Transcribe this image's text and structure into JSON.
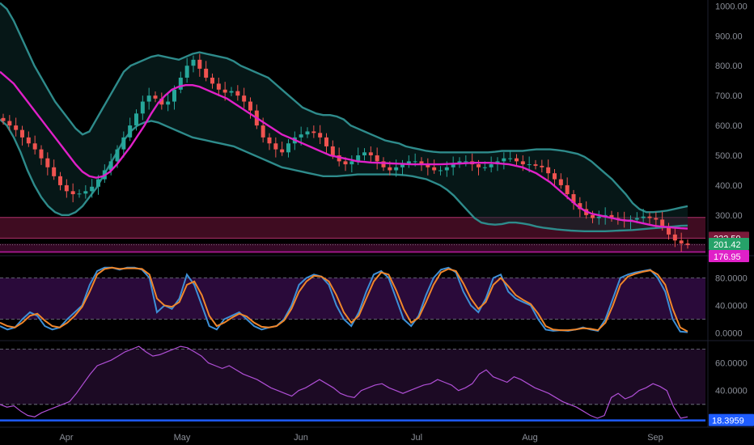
{
  "chart_data": [
    {
      "type": "candlestick",
      "panel": "price",
      "indicators": [
        "bollinger-bands",
        "moving-average"
      ],
      "y_ticks": [
        "1000.00",
        "900.00",
        "800.00",
        "700.00",
        "600.00",
        "500.00",
        "400.00",
        "300.00"
      ],
      "ylim": [
        175,
        1020
      ],
      "badges": [
        {
          "label": "222.59",
          "value": 222.59,
          "color": "#7a1a3a",
          "text_color": "#ffffff"
        },
        {
          "label": "201.42",
          "value": 201.42,
          "color": "#26a269",
          "text_color": "#ffffff"
        },
        {
          "label": "176.95",
          "value": 176.95,
          "color": "#e020c8",
          "text_color": "#ffffff"
        }
      ],
      "colors": {
        "up": "#26a69a",
        "down": "#ef5350",
        "bands": "#2e8b8b",
        "ma": "#e020c8",
        "zone": "#8b1a4a"
      },
      "closes": [
        615,
        600,
        585,
        560,
        540,
        520,
        490,
        460,
        430,
        400,
        380,
        370,
        372,
        380,
        395,
        420,
        450,
        480,
        520,
        560,
        600,
        640,
        680,
        700,
        690,
        670,
        680,
        720,
        760,
        800,
        820,
        790,
        760,
        740,
        720,
        710,
        715,
        700,
        680,
        650,
        600,
        560,
        540,
        520,
        510,
        540,
        560,
        570,
        580,
        575,
        560,
        530,
        500,
        480,
        470,
        480,
        500,
        510,
        500,
        480,
        460,
        450,
        460,
        470,
        480,
        480,
        470,
        460,
        450,
        450,
        460,
        470,
        480,
        480,
        470,
        460,
        460,
        470,
        480,
        490,
        490,
        480,
        470,
        470,
        465,
        460,
        440,
        420,
        400,
        370,
        340,
        320,
        300,
        290,
        295,
        300,
        290,
        285,
        280,
        285,
        290,
        295,
        290,
        285,
        260,
        235,
        215,
        205,
        200
      ],
      "series": [
        {
          "name": "BB upper",
          "values": [
            1010,
            990,
            950,
            900,
            850,
            800,
            760,
            720,
            680,
            650,
            620,
            590,
            570,
            580,
            620,
            660,
            700,
            740,
            780,
            800,
            810,
            820,
            830,
            835,
            830,
            825,
            820,
            830,
            840,
            845,
            840,
            835,
            830,
            825,
            815,
            800,
            790,
            780,
            770,
            760,
            740,
            720,
            700,
            680,
            660,
            650,
            640,
            635,
            635,
            630,
            620,
            600,
            590,
            580,
            570,
            560,
            550,
            545,
            540,
            530,
            525,
            520,
            515,
            512,
            510,
            510,
            510,
            510,
            510,
            510,
            510,
            510,
            512,
            515,
            515,
            515,
            515,
            518,
            520,
            520,
            520,
            518,
            515,
            510,
            505,
            495,
            480,
            460,
            440,
            420,
            395,
            370,
            340,
            320,
            310,
            310,
            312,
            315,
            320,
            325,
            330
          ]
        },
        {
          "name": "Moving average",
          "values": [
            780,
            760,
            740,
            710,
            680,
            650,
            620,
            590,
            560,
            530,
            500,
            470,
            445,
            430,
            425,
            430,
            445,
            470,
            500,
            530,
            565,
            600,
            640,
            675,
            700,
            720,
            730,
            735,
            735,
            730,
            720,
            710,
            700,
            690,
            675,
            660,
            645,
            630,
            615,
            600,
            585,
            570,
            560,
            550,
            540,
            530,
            520,
            510,
            500,
            495,
            490,
            485,
            480,
            478,
            476,
            475,
            474,
            473,
            472,
            471,
            470,
            470,
            470,
            470,
            470,
            471,
            472,
            473,
            474,
            475,
            475,
            475,
            474,
            472,
            470,
            465,
            460,
            450,
            440,
            425,
            410,
            390,
            370,
            350,
            330,
            315,
            305,
            300,
            295,
            290,
            285,
            282,
            280,
            275,
            270,
            265,
            262,
            260,
            258,
            256,
            255
          ]
        },
        {
          "name": "BB lower",
          "values": [
            620,
            600,
            560,
            510,
            450,
            400,
            360,
            330,
            310,
            300,
            300,
            310,
            330,
            360,
            390,
            430,
            470,
            510,
            550,
            580,
            600,
            610,
            615,
            610,
            600,
            590,
            580,
            570,
            560,
            555,
            550,
            545,
            540,
            535,
            530,
            520,
            510,
            500,
            490,
            480,
            470,
            460,
            455,
            450,
            445,
            440,
            435,
            430,
            430,
            430,
            432,
            434,
            436,
            436,
            436,
            436,
            436,
            436,
            435,
            433,
            430,
            425,
            420,
            410,
            400,
            385,
            365,
            340,
            315,
            290,
            275,
            270,
            268,
            270,
            275,
            275,
            272,
            268,
            262,
            258,
            255,
            252,
            250,
            248,
            247,
            246,
            246,
            246,
            246,
            247,
            248,
            249,
            250,
            252,
            254,
            256,
            258,
            260,
            262,
            264,
            265
          ]
        }
      ]
    },
    {
      "type": "line",
      "panel": "stochastic",
      "y_ticks": [
        "80.0000",
        "40.0000",
        "0.0000"
      ],
      "ylim": [
        -10,
        110
      ],
      "bands": [
        20,
        80
      ],
      "series": [
        {
          "name": "%K",
          "color": "#3d8fd6",
          "values": [
            10,
            5,
            8,
            20,
            30,
            25,
            10,
            5,
            8,
            20,
            30,
            40,
            70,
            90,
            95,
            95,
            92,
            95,
            95,
            92,
            80,
            30,
            40,
            35,
            50,
            85,
            70,
            40,
            10,
            5,
            20,
            25,
            30,
            20,
            10,
            5,
            8,
            10,
            20,
            40,
            70,
            80,
            85,
            82,
            70,
            40,
            20,
            10,
            30,
            60,
            85,
            90,
            80,
            50,
            20,
            10,
            25,
            55,
            80,
            92,
            95,
            88,
            60,
            40,
            30,
            50,
            80,
            85,
            60,
            50,
            45,
            40,
            20,
            5,
            3,
            4,
            3,
            5,
            8,
            5,
            3,
            20,
            50,
            80,
            85,
            88,
            90,
            92,
            80,
            60,
            20,
            2,
            1
          ]
        },
        {
          "name": "%D",
          "color": "#f0862a",
          "values": [
            15,
            10,
            8,
            15,
            25,
            28,
            18,
            10,
            8,
            15,
            25,
            38,
            60,
            85,
            93,
            95,
            93,
            94,
            94,
            93,
            85,
            50,
            40,
            38,
            45,
            70,
            75,
            55,
            25,
            10,
            15,
            22,
            28,
            24,
            15,
            9,
            8,
            10,
            18,
            35,
            60,
            75,
            83,
            82,
            75,
            55,
            30,
            15,
            25,
            50,
            75,
            88,
            85,
            62,
            35,
            15,
            22,
            45,
            70,
            88,
            93,
            90,
            72,
            50,
            35,
            45,
            70,
            80,
            68,
            55,
            48,
            42,
            28,
            10,
            5,
            4,
            4,
            5,
            7,
            6,
            4,
            15,
            40,
            70,
            82,
            86,
            89,
            91,
            85,
            70,
            35,
            8,
            2
          ]
        }
      ]
    },
    {
      "type": "line",
      "panel": "rsi",
      "y_ticks": [
        "60.0000",
        "40.0000"
      ],
      "ylim": [
        17,
        75
      ],
      "bands": [
        30,
        70
      ],
      "badges": [
        {
          "label": "18.3959",
          "value": 18.3959,
          "color": "#1e5cff",
          "text_color": "#ffffff"
        }
      ],
      "series": [
        {
          "name": "RSI",
          "color": "#b04fd6",
          "values": [
            30,
            28,
            29,
            25,
            22,
            21,
            24,
            26,
            28,
            30,
            32,
            38,
            45,
            52,
            58,
            60,
            62,
            65,
            68,
            70,
            72,
            68,
            65,
            66,
            68,
            70,
            72,
            71,
            68,
            65,
            60,
            58,
            56,
            58,
            55,
            52,
            50,
            48,
            45,
            42,
            40,
            38,
            36,
            40,
            42,
            45,
            48,
            45,
            42,
            38,
            36,
            35,
            40,
            42,
            44,
            45,
            42,
            40,
            38,
            40,
            42,
            44,
            45,
            48,
            46,
            44,
            40,
            42,
            45,
            52,
            55,
            50,
            48,
            46,
            50,
            48,
            45,
            42,
            40,
            38,
            35,
            32,
            30,
            28,
            25,
            22,
            20,
            22,
            35,
            38,
            34,
            36,
            40,
            42,
            45,
            43,
            40,
            28,
            20,
            21
          ]
        }
      ]
    }
  ],
  "x_axis": {
    "labels": [
      "Apr",
      "May",
      "Jun",
      "Jul",
      "Aug",
      "Sep"
    ]
  },
  "colors": {
    "background": "#000000",
    "axis_text": "#8b8f98",
    "stoch_band_fill": "#2a0a3a",
    "rsi_band_fill": "#1c0a24",
    "separator": "#1e2030"
  }
}
